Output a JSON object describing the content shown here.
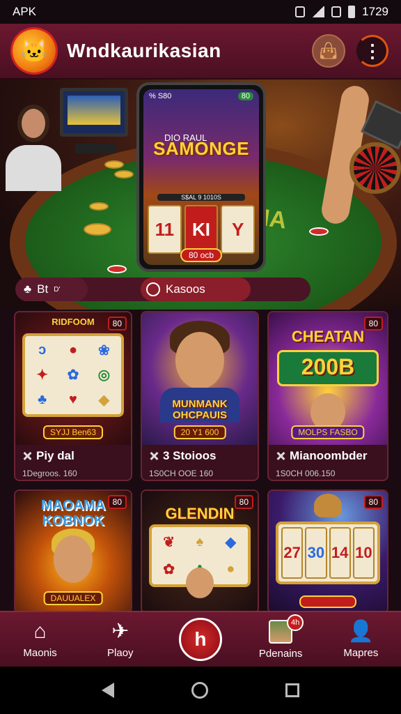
{
  "status": {
    "left": "APK",
    "time": "1729"
  },
  "app": {
    "title": "Wndkaurikasian",
    "logo_icon": "🐱",
    "wallet_icon": "👜",
    "menu_icon": "⋮"
  },
  "hero": {
    "phone": {
      "top_left": "% S80",
      "top_badge": "80",
      "sub": "DIO RAUL",
      "title": "SAMONGE",
      "line": "S$AL 9 1010S",
      "reels": [
        "11",
        "KI",
        "Y"
      ],
      "spin": "80 ocb"
    },
    "felt_text": "VIA"
  },
  "tabs": [
    {
      "label": "Bt",
      "sup": "D'"
    },
    {
      "label": "Kasoos"
    }
  ],
  "cards": [
    {
      "header": "RIDFOOM",
      "badge": "80",
      "banner": "SYJJ Ben63",
      "name": "Piy dal",
      "meta": "1Degroos. 160"
    },
    {
      "header": "",
      "badge": "",
      "big": "MUNMANK OHCPAUIS",
      "banner": "20 Y1 600",
      "name": "3 Stoioos",
      "meta": "1S0CH OOE 160"
    },
    {
      "header": "",
      "badge": "80",
      "big": "CHEATAN",
      "big2": "200B",
      "banner": "MOLPS FASBO",
      "name": "Mianoombder",
      "meta": "1S0CH 006.150"
    },
    {
      "header": "",
      "badge": "80",
      "big": "MAOAMA KOBNOK",
      "banner": "DAUUALEX",
      "name": "",
      "meta": ""
    },
    {
      "header": "",
      "badge": "80",
      "big": "GLENDIN",
      "banner": "",
      "name": "",
      "meta": ""
    },
    {
      "header": "",
      "badge": "80",
      "reels": [
        "27",
        "30",
        "14",
        "10"
      ],
      "banner": "",
      "name": "",
      "meta": ""
    }
  ],
  "bottom_nav": {
    "items": [
      {
        "label": "Maonis",
        "icon": "⌂"
      },
      {
        "label": "Plaoy",
        "icon": "✈"
      },
      {
        "label": "",
        "icon": "h"
      },
      {
        "label": "Pdenains",
        "badge": "4h"
      },
      {
        "label": "Mapres",
        "icon": "👤"
      }
    ]
  }
}
